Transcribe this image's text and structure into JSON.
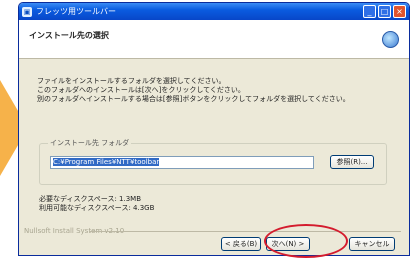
{
  "window": {
    "title": "フレッツ用ツールバー",
    "minimize": "_",
    "maximize": "□",
    "close": "×"
  },
  "header": {
    "title": "インストール先の選択"
  },
  "description": [
    "ファイルをインストールするフォルダを選択してください。",
    "このフォルダへのインストールは[次へ]をクリックしてください。",
    "別のフォルダへインストールする場合は[参照]ボタンをクリックしてフォルダを選択してください。"
  ],
  "install_folder": {
    "label": "インストール先 フォルダ",
    "path": "C:¥Program Files¥NTT¥toolbar",
    "browse_label": "参照(R)..."
  },
  "space": {
    "required": "必要なディスクスペース: 1.3MB",
    "available": "利用可能なディスクスペース: 4.3GB"
  },
  "footer": {
    "brand": "Nullsoft Install System v2.10"
  },
  "buttons": {
    "back": "< 戻る(B)",
    "next": "次へ(N) >",
    "cancel": "キャンセル"
  },
  "colors": {
    "highlight_ellipse": "#d41c2e",
    "arrow": "#f6b24a"
  }
}
